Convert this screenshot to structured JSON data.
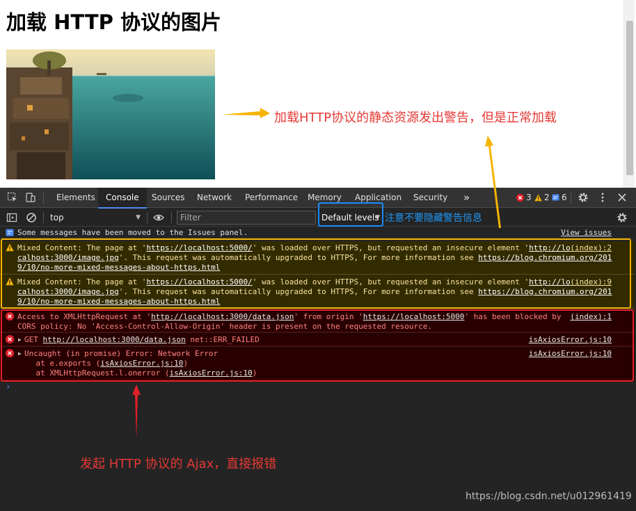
{
  "page": {
    "heading": "加载 HTTP 协议的图片"
  },
  "devtools": {
    "tabs": [
      "Elements",
      "Console",
      "Sources",
      "Network",
      "Performance",
      "Memory",
      "Application",
      "Security"
    ],
    "more_tabs": "»",
    "counts": {
      "errors": "3",
      "warnings": "2",
      "issues": "6"
    }
  },
  "filterbar": {
    "context": "top",
    "filter_placeholder": "Filter",
    "levels": "Default levels"
  },
  "console": {
    "issues_notice": "Some messages have been moved to the Issues panel.",
    "view_issues": "View issues",
    "warnings": [
      {
        "l1a": "Mixed Content: The page at '",
        "l1b": "https://localhost:5000/",
        "l1c": "' was loaded over HTTPS, but requested an insecure element '",
        "l1d": "http://lo",
        "l2a": "calhost:3000/image.jpg",
        "l2b": "'. This request was automatically upgraded to HTTPS, For more information see ",
        "l2c": "https://blog.chromium.org/201",
        "l3": "9/10/no-more-mixed-messages-about-https.html",
        "source": "(index):2"
      },
      {
        "l1a": "Mixed Content: The page at '",
        "l1b": "https://localhost:5000/",
        "l1c": "' was loaded over HTTPS, but requested an insecure element '",
        "l1d": "http://lo",
        "l2a": "calhost:3000/image.jpg",
        "l2b": "'. This request was automatically upgraded to HTTPS, For more information see ",
        "l2c": "https://blog.chromium.org/201",
        "l3": "9/10/no-more-mixed-messages-about-https.html",
        "source": "(index):9"
      }
    ],
    "errors": {
      "cors": {
        "l1a": "Access to XMLHttpRequest at '",
        "l1b": "http://localhost:3000/data.json",
        "l1c": "' from origin '",
        "l1d": "https://localhost:5000",
        "l1e": "' has been blocked by",
        "l2": "CORS policy: No 'Access-Control-Allow-Origin' header is present on the requested resource.",
        "source": "(index):1"
      },
      "get": {
        "method": "GET ",
        "url": "http://localhost:3000/data.json",
        "status": " net::ERR_FAILED",
        "source": "isAxiosError.js:10"
      },
      "uncaught": {
        "l1": "Uncaught (in promise) Error: Network Error",
        "l2a": "    at e.exports (",
        "l2b": "isAxiosError.js:10",
        "l2c": ")",
        "l3a": "    at XMLHttpRequest.l.onerror (",
        "l3b": "isAxiosError.js:10",
        "l3c": ")",
        "source": "isAxiosError.js:10"
      }
    },
    "prompt": "›"
  },
  "annotations": {
    "loaded": "加载HTTP协议的静态资源发出警告，但是正常加载",
    "levels_note": "注意不要隐藏警告信息",
    "ajax": "发起 HTTP 协议的 Ajax，直接报错",
    "watermark": "https://blog.csdn.net/u012961419"
  },
  "colors": {
    "warning_box": "#f5b400",
    "error_box": "#e0202a",
    "levels_box": "#1a8cff",
    "annotation_red": "#e53935",
    "annotation_blue": "#2196f3"
  }
}
